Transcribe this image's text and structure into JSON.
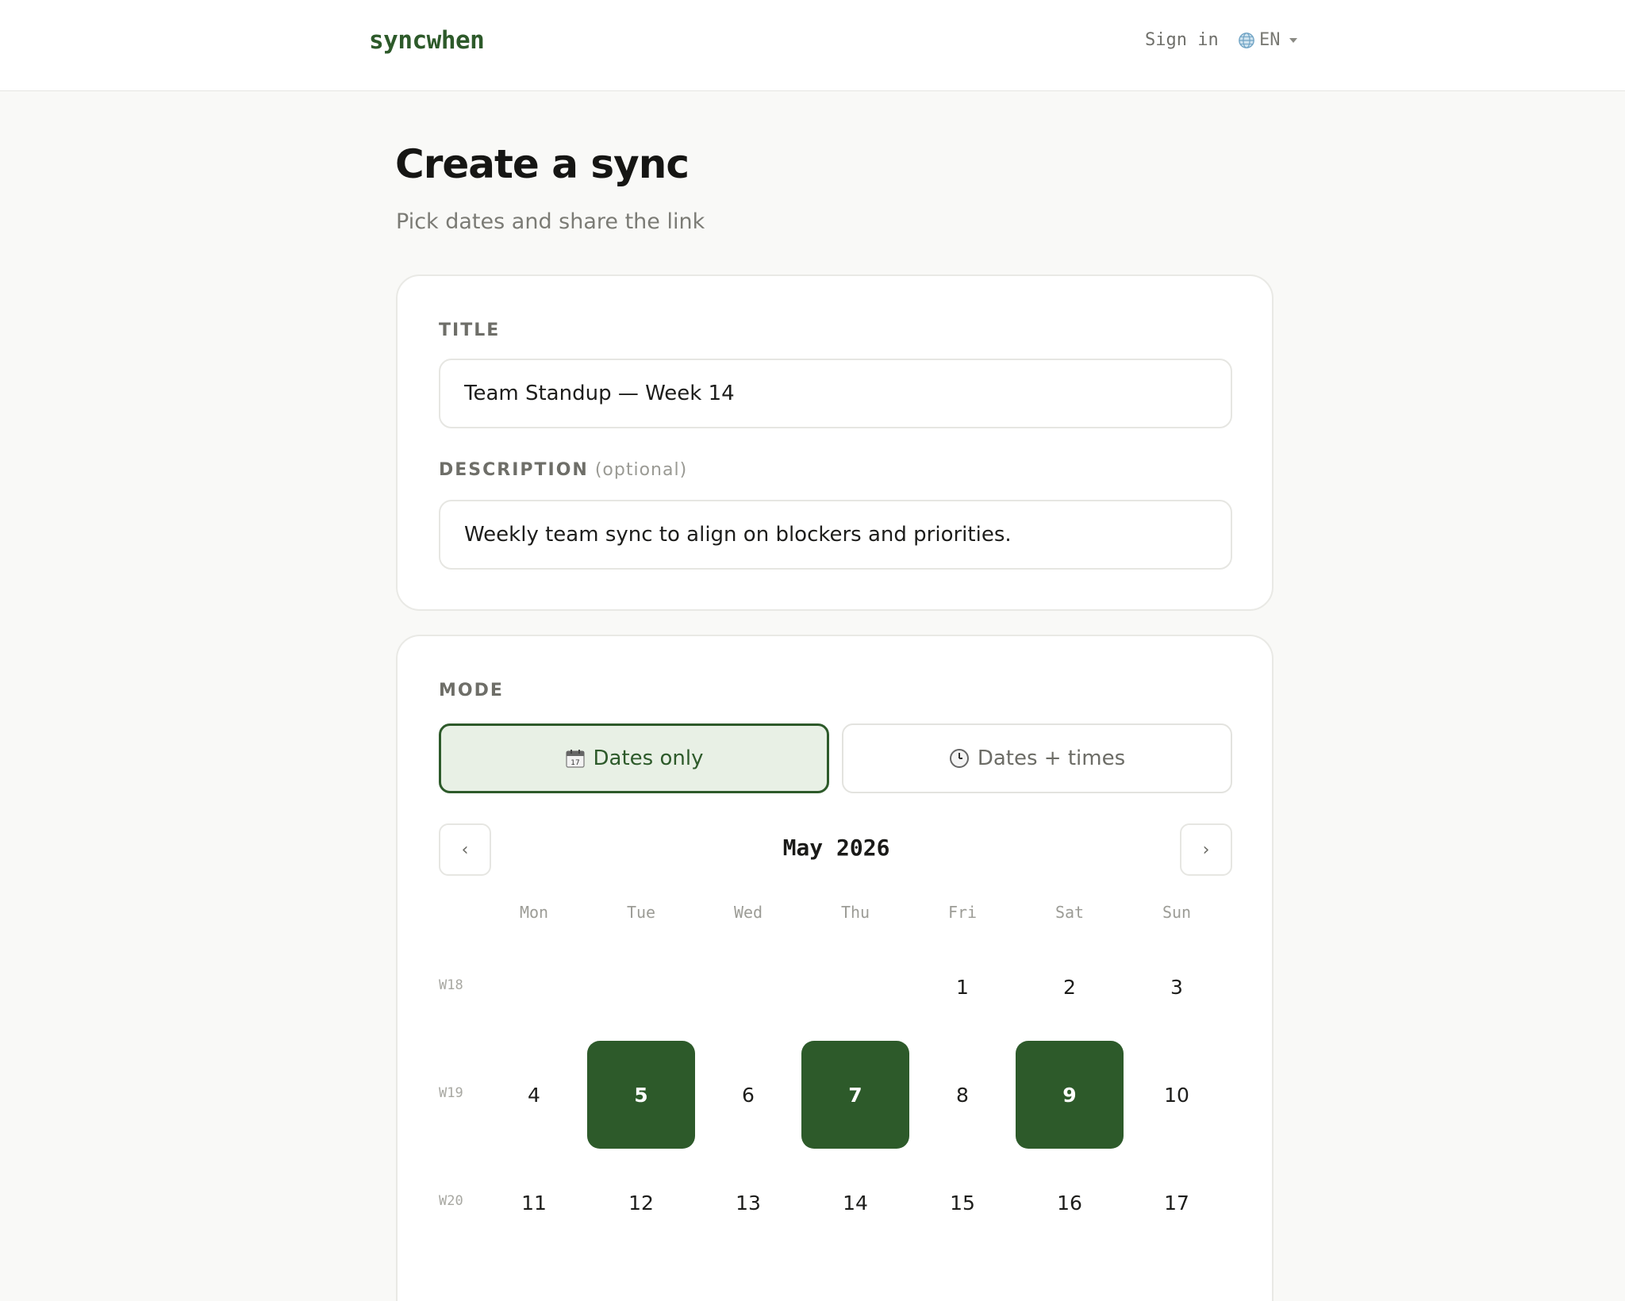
{
  "header": {
    "brand": "syncwhen",
    "sign_in": "Sign in",
    "language": "EN"
  },
  "page": {
    "title": "Create a sync",
    "subtitle": "Pick dates and share the link"
  },
  "form": {
    "title_label": "TITLE",
    "title_value": "Team Standup — Week 14",
    "description_label": "DESCRIPTION",
    "description_optional": "(optional)",
    "description_value": "Weekly team sync to align on blockers and priorities."
  },
  "mode": {
    "label": "MODE",
    "dates_only": "Dates only",
    "dates_times": "Dates + times",
    "selected": "dates_only"
  },
  "calendar": {
    "month": "May",
    "year": "2026",
    "prev": "‹",
    "next": "›",
    "weekdays": [
      "Mon",
      "Tue",
      "Wed",
      "Thu",
      "Fri",
      "Sat",
      "Sun"
    ],
    "weeks": [
      {
        "label": "W18",
        "days": [
          "",
          "",
          "",
          "",
          "1",
          "2",
          "3"
        ]
      },
      {
        "label": "W19",
        "days": [
          "4",
          "5",
          "6",
          "7",
          "8",
          "9",
          "10"
        ]
      },
      {
        "label": "W20",
        "days": [
          "11",
          "12",
          "13",
          "14",
          "15",
          "16",
          "17"
        ]
      }
    ],
    "selected": [
      "5",
      "7",
      "9"
    ]
  },
  "colors": {
    "accent": "#2d5a2a",
    "accent_light": "#e8f0e5"
  }
}
